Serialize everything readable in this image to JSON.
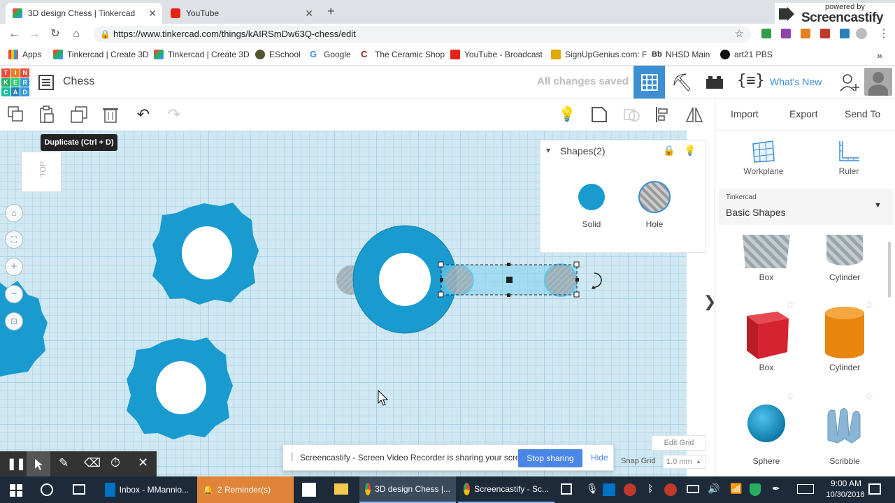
{
  "browser": {
    "tabs": [
      {
        "title": "3D design Chess | Tinkercad",
        "active": true
      },
      {
        "title": "YouTube",
        "active": false
      }
    ],
    "url": "https://www.tinkercad.com/things/kAIRSmDw63Q-chess/edit",
    "bookmarks": [
      "Apps",
      "Tinkercad | Create 3D",
      "Tinkercad | Create 3D",
      "ESchool",
      "Google",
      "The Ceramic Shop",
      "YouTube - Broadcast",
      "SignUpGenius.com: F",
      "NHSD Main",
      "art21 PBS"
    ],
    "more_bookmarks": "»",
    "screencastify_badge": {
      "line1": "powered by",
      "line2": "Screencastify"
    }
  },
  "app": {
    "logo_letters": [
      "T",
      "I",
      "N",
      "K",
      "E",
      "R",
      "C",
      "A",
      "D"
    ],
    "design_title": "Chess",
    "save_status": "All changes saved",
    "whats_new": "What's New",
    "toolbar": {
      "import": "Import",
      "export": "Export",
      "send_to": "Send To",
      "tooltip": "Duplicate (Ctrl + D)"
    },
    "view_cube_label": "TOP",
    "inspector": {
      "title": "Shapes(2)",
      "solid_label": "Solid",
      "hole_label": "Hole"
    },
    "right_panel": {
      "workplane_label": "Workplane",
      "ruler_label": "Ruler",
      "library_source": "Tinkercad",
      "library_name": "Basic Shapes",
      "shapes": [
        {
          "label": "Box",
          "style": "hole"
        },
        {
          "label": "Cylinder",
          "style": "hole"
        },
        {
          "label": "Box",
          "style": "solid"
        },
        {
          "label": "Cylinder",
          "style": "solid"
        },
        {
          "label": "Sphere",
          "style": "solid"
        },
        {
          "label": "Scribble",
          "style": "solid"
        }
      ]
    },
    "edit_grid": "Edit Grid",
    "snap_grid_label": "Snap Grid",
    "snap_grid_value": "1.0 mm"
  },
  "screencastify": {
    "message": "Screencastify - Screen Video Recorder is sharing your screen.",
    "stop_button": "Stop sharing",
    "hide_button": "Hide"
  },
  "taskbar": {
    "items": [
      "Inbox - MMannio...",
      "2 Reminder(s)",
      "3D design Chess |...",
      "Screencastify - Sc..."
    ],
    "time": "9:00 AM",
    "date": "10/30/2018"
  },
  "colors": {
    "accent": "#1c9fd8",
    "header_blue": "#3d8fd4",
    "shape_blue": "#1a9bd0",
    "red_box": "#d6232f",
    "orange_cyl": "#e8850f"
  }
}
